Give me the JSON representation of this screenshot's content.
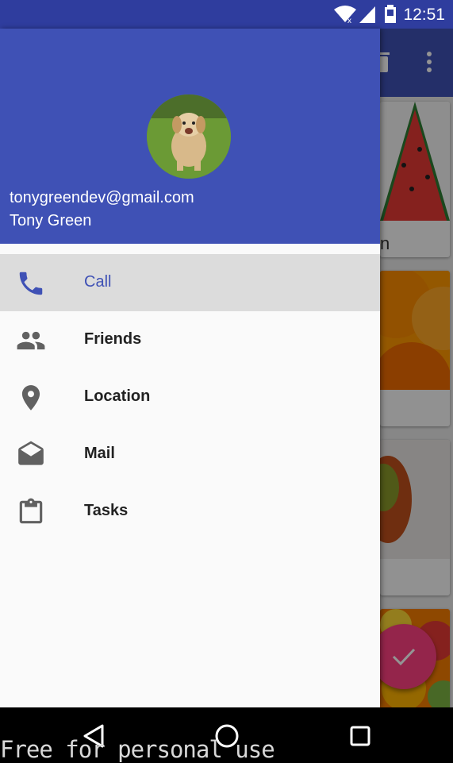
{
  "status_bar": {
    "time": "12:51",
    "icons": [
      "wifi-icon",
      "signal-icon",
      "battery-icon"
    ]
  },
  "background_app": {
    "toolbar_icons": [
      "delete-icon",
      "more-vert-icon"
    ],
    "cards": [
      {
        "image": "watermelon",
        "caption": "n"
      },
      {
        "image": "oranges",
        "caption": ""
      },
      {
        "image": "mango",
        "caption": ""
      },
      {
        "image": "mixed-fruit",
        "caption": ""
      }
    ],
    "fab_icon": "check-icon",
    "colors": {
      "primary": "#3f51b5",
      "accent": "#ff4081"
    }
  },
  "drawer": {
    "header": {
      "email": "tonygreendev@gmail.com",
      "name": "Tony Green",
      "avatar": "puppy-photo"
    },
    "items": [
      {
        "label": "Call",
        "icon": "phone-icon",
        "selected": true
      },
      {
        "label": "Friends",
        "icon": "people-icon",
        "selected": false
      },
      {
        "label": "Location",
        "icon": "location-pin-icon",
        "selected": false
      },
      {
        "label": "Mail",
        "icon": "mail-icon",
        "selected": false
      },
      {
        "label": "Tasks",
        "icon": "clipboard-icon",
        "selected": false
      }
    ]
  },
  "nav_bar": {
    "buttons": [
      "back-icon",
      "home-icon",
      "recents-icon"
    ]
  },
  "watermark": "Free for personal use"
}
